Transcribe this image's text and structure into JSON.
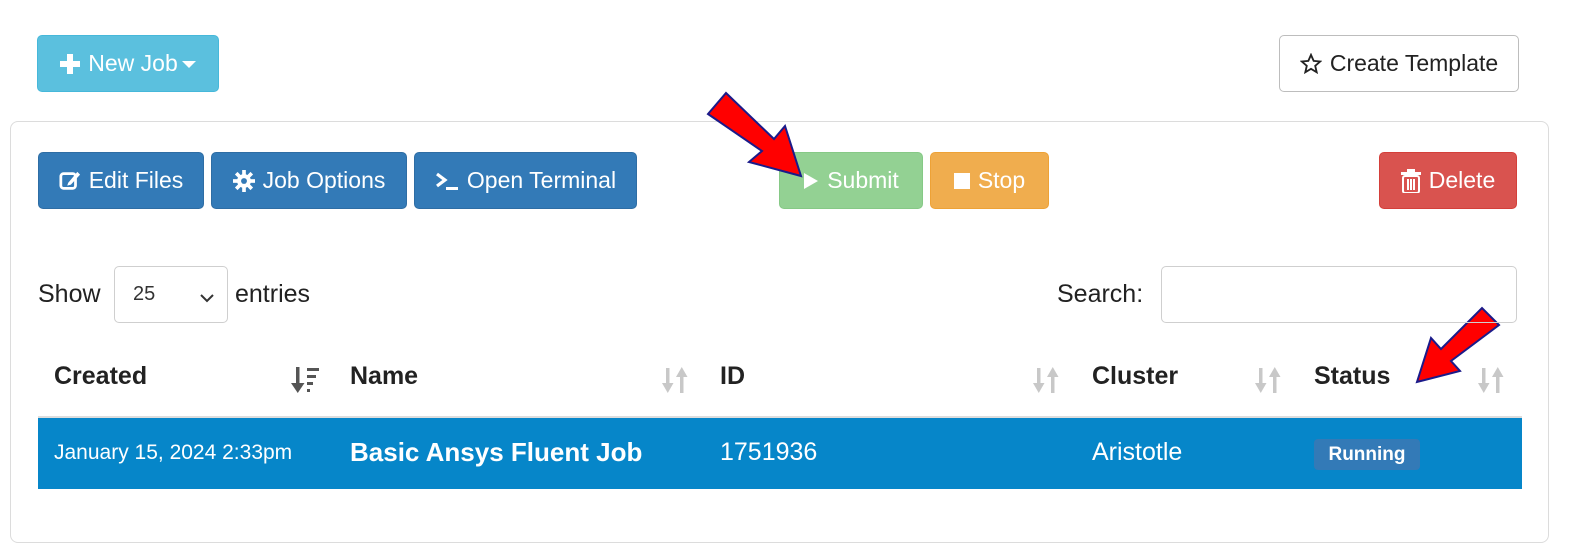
{
  "toolbar": {
    "new_job_label": "New Job",
    "create_template_label": "Create Template"
  },
  "actions": {
    "edit_files": "Edit Files",
    "job_options": "Job Options",
    "open_terminal": "Open Terminal",
    "submit": "Submit",
    "stop": "Stop",
    "delete": "Delete"
  },
  "table_controls": {
    "show_label": "Show",
    "entries_value": "25",
    "entries_label": "entries",
    "search_label": "Search:",
    "search_value": ""
  },
  "table": {
    "columns": [
      "Created",
      "Name",
      "ID",
      "Cluster",
      "Status"
    ],
    "rows": [
      {
        "created": "January 15, 2024 2:33pm",
        "name": "Basic Ansys Fluent Job",
        "id": "1751936",
        "cluster": "Aristotle",
        "status": "Running"
      }
    ]
  },
  "colors": {
    "new_job": "#5bc0de",
    "primary": "#337ab7",
    "submit": "#93d193",
    "stop": "#f0ad4e",
    "delete": "#d9534f",
    "selected_row": "#0686c9",
    "annotation_arrow": "#ff0000"
  },
  "icons": {
    "new_job": "plus-icon",
    "new_job_caret": "caret-down-icon",
    "create_template": "star-outline-icon",
    "edit_files": "edit-icon",
    "job_options": "gear-icon",
    "open_terminal": "terminal-icon",
    "submit": "play-icon",
    "stop": "stop-icon",
    "delete": "trash-icon",
    "sort_active": "sort-desc-icon",
    "sort": "sort-icon"
  }
}
